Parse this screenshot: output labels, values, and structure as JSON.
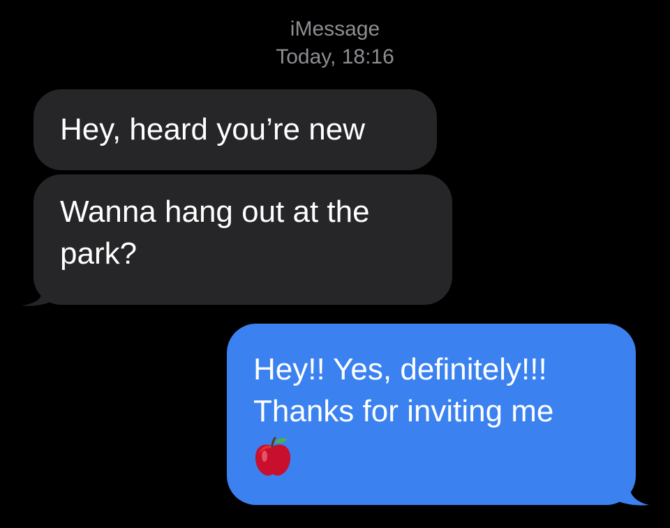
{
  "header": {
    "service": "iMessage",
    "timestamp": "Today, 18:16"
  },
  "colors": {
    "background": "#000000",
    "incoming_bubble": "#262628",
    "outgoing_bubble": "#3b82f0",
    "header_text": "#8e8e93",
    "message_text": "#ffffff"
  },
  "messages": [
    {
      "direction": "incoming",
      "text": "Hey, heard you’re new"
    },
    {
      "direction": "incoming",
      "text": "Wanna hang out at the park?"
    },
    {
      "direction": "outgoing",
      "lines": [
        "Hey!! Yes, definitely!!!",
        "Thanks for inviting me"
      ],
      "emoji": "apple-icon"
    }
  ]
}
